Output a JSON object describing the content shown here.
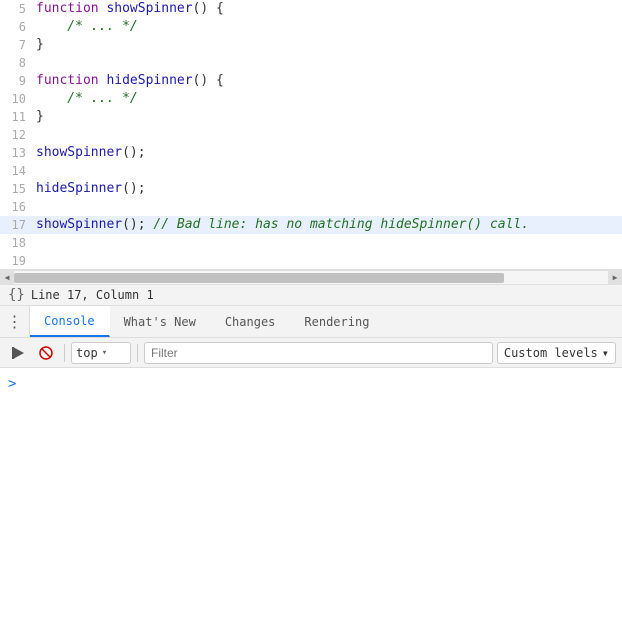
{
  "editor": {
    "lines": [
      {
        "num": "5",
        "tokens": [
          {
            "text": "function ",
            "cls": "kw"
          },
          {
            "text": "showSpinner",
            "cls": "fn-name"
          },
          {
            "text": "() {",
            "cls": "punc"
          }
        ],
        "cursor": false
      },
      {
        "num": "6",
        "tokens": [
          {
            "text": "    /* ... */",
            "cls": "comment"
          }
        ],
        "cursor": false
      },
      {
        "num": "7",
        "tokens": [
          {
            "text": "}",
            "cls": "punc"
          }
        ],
        "cursor": false
      },
      {
        "num": "8",
        "tokens": [],
        "cursor": false
      },
      {
        "num": "9",
        "tokens": [
          {
            "text": "function ",
            "cls": "kw"
          },
          {
            "text": "hideSpinner",
            "cls": "fn-name"
          },
          {
            "text": "() {",
            "cls": "punc"
          }
        ],
        "cursor": false
      },
      {
        "num": "10",
        "tokens": [
          {
            "text": "    /* ... */",
            "cls": "comment"
          }
        ],
        "cursor": false
      },
      {
        "num": "11",
        "tokens": [
          {
            "text": "}",
            "cls": "punc"
          }
        ],
        "cursor": false
      },
      {
        "num": "12",
        "tokens": [],
        "cursor": false
      },
      {
        "num": "13",
        "tokens": [
          {
            "text": "showSpinner",
            "cls": "call"
          },
          {
            "text": "();",
            "cls": "punc"
          }
        ],
        "cursor": false
      },
      {
        "num": "14",
        "tokens": [],
        "cursor": false
      },
      {
        "num": "15",
        "tokens": [
          {
            "text": "hideSpinner",
            "cls": "call"
          },
          {
            "text": "();",
            "cls": "punc"
          }
        ],
        "cursor": false
      },
      {
        "num": "16",
        "tokens": [],
        "cursor": false
      },
      {
        "num": "17",
        "tokens": [
          {
            "text": "showSpinner",
            "cls": "call"
          },
          {
            "text": "(); ",
            "cls": "punc"
          },
          {
            "text": "// Bad line: has no matching hideSpinner() call.",
            "cls": "bad-comment"
          }
        ],
        "cursor": true
      },
      {
        "num": "18",
        "tokens": [],
        "cursor": false
      },
      {
        "num": "19",
        "tokens": [],
        "cursor": false
      }
    ]
  },
  "scrollbar": {
    "left_arrow": "◀",
    "right_arrow": "▶"
  },
  "status_bar": {
    "icon": "{}",
    "text": "Line 17, Column 1"
  },
  "toolbar": {
    "menu_icon": "⋮",
    "tabs": [
      {
        "label": "Console",
        "active": true
      },
      {
        "label": "What's New",
        "active": false
      },
      {
        "label": "Changes",
        "active": false
      },
      {
        "label": "Rendering",
        "active": false
      }
    ]
  },
  "filter_bar": {
    "clear_icon": "🚫",
    "top_label": "top",
    "filter_placeholder": "Filter",
    "custom_levels_label": "Custom levels",
    "dropdown_arrow": "▾"
  },
  "console": {
    "prompt_arrow": ">"
  }
}
